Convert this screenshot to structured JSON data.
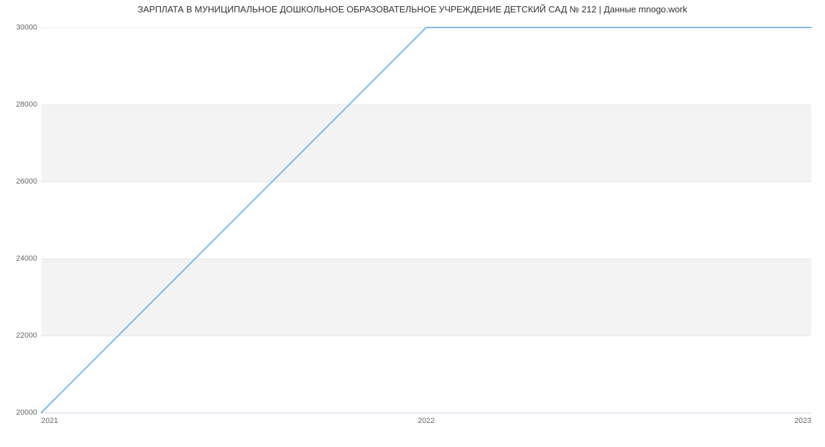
{
  "chart_data": {
    "type": "line",
    "title": "ЗАРПЛАТА В МУНИЦИПАЛЬНОЕ ДОШКОЛЬНОЕ ОБРАЗОВАТЕЛЬНОЕ УЧРЕЖДЕНИЕ ДЕТСКИЙ САД № 212 | Данные mnogo.work",
    "x": [
      2021,
      2022,
      2023
    ],
    "series": [
      {
        "name": "salary",
        "values": [
          20000,
          30000,
          30000
        ],
        "color": "#7cb5ec"
      }
    ],
    "xlabel": "",
    "ylabel": "",
    "ylim": [
      20000,
      30000
    ],
    "xlim": [
      2021,
      2023
    ],
    "y_ticks": [
      20000,
      22000,
      24000,
      26000,
      28000,
      30000
    ],
    "x_ticks": [
      2021,
      2022,
      2023
    ],
    "grid": true
  }
}
